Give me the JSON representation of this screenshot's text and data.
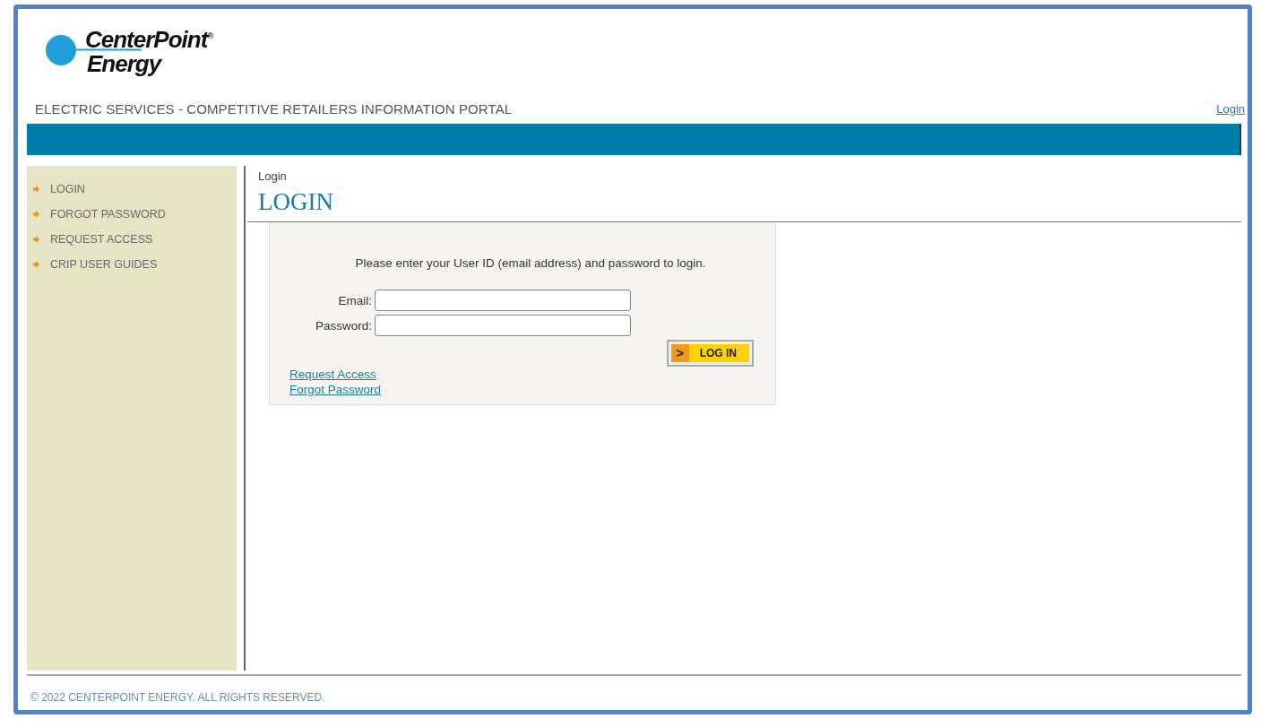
{
  "logo": {
    "line_1": "CenterPoint$^{®}$",
    "line_2": "Energy"
  },
  "header": {
    "title": "ELECTRIC SERVICES - COMPETITIVE RETAILERS INFORMATION PORTAL",
    "login_link": "Login"
  },
  "sidebar": {
    "items": [
      {
        "label": "LOGIN"
      },
      {
        "label": "FORGOT PASSWORD"
      },
      {
        "label": "REQUEST ACCESS"
      },
      {
        "label": "CRIP USER GUIDES"
      }
    ]
  },
  "breadcrumb": "Login",
  "page_title": "LOGIN",
  "form": {
    "instructions": "Please enter your User ID (email address) and password to login.",
    "fields": [
      {
        "label": "Email:"
      },
      {
        "label": "Password:"
      }
    ],
    "button": {
      "icon": ">",
      "label": "LOG IN"
    },
    "links": [
      "Request Access",
      "Forgot Password"
    ]
  },
  "footer": "© 2022 CENTERPOINT ENERGY. ALL RIGHTS RESERVED."
}
